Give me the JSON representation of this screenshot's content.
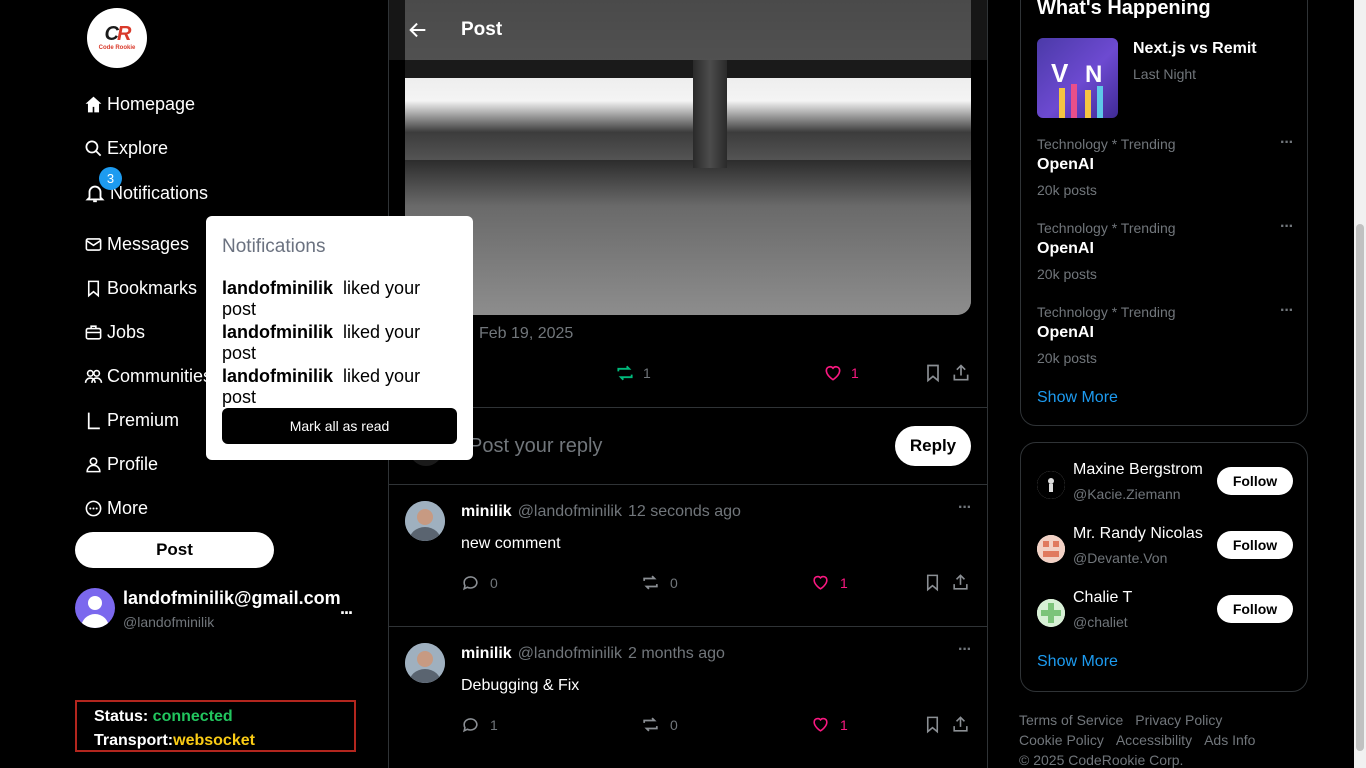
{
  "brand": {
    "logo_text": "CR",
    "logo_sub": "Code Rookie"
  },
  "nav": {
    "homepage": "Homepage",
    "explore": "Explore",
    "notifications": "Notifications",
    "notifications_count": "3",
    "messages": "Messages",
    "bookmarks": "Bookmarks",
    "jobs": "Jobs",
    "communities": "Communities",
    "premium": "Premium",
    "profile": "Profile",
    "more": "More",
    "post_button": "Post"
  },
  "account": {
    "email": "landofminilik@gmail.com",
    "handle": "@landofminilik",
    "more": "..."
  },
  "status": {
    "status_label": "Status: ",
    "status_value": "connected",
    "transport_label": "Transport:",
    "transport_value": "websocket"
  },
  "notifications_popover": {
    "title": "Notifications",
    "items": [
      {
        "user": "landofminilik",
        "action": "liked your post"
      },
      {
        "user": "landofminilik",
        "action": "liked your post"
      },
      {
        "user": "landofminilik",
        "action": "liked your post"
      }
    ],
    "mark_all": "Mark all as read"
  },
  "main": {
    "header_title": "Post",
    "date": "Feb 19, 2025",
    "repost_count": "1",
    "like_count": "1",
    "reply_placeholder": "Post your reply",
    "reply_button": "Reply",
    "comments": [
      {
        "name": "minilik",
        "handle": "@landofminilik",
        "time": "12 seconds ago",
        "text": "new comment",
        "replies": "0",
        "reposts": "0",
        "likes": "1"
      },
      {
        "name": "minilik",
        "handle": "@landofminilik",
        "time": "2 months ago",
        "text": "Debugging & Fix",
        "replies": "1",
        "reposts": "0",
        "likes": "1"
      }
    ]
  },
  "right": {
    "happening_title": "What's Happening",
    "event": {
      "title": "Next.js vs Remit",
      "time": "Last Night"
    },
    "trends": [
      {
        "category": "Technology * Trending",
        "tag": "OpenAI",
        "count": "20k posts"
      },
      {
        "category": "Technology * Trending",
        "tag": "OpenAI",
        "count": "20k posts"
      },
      {
        "category": "Technology * Trending",
        "tag": "OpenAI",
        "count": "20k posts"
      }
    ],
    "show_more": "Show More",
    "who_to_follow": [
      {
        "name": "Maxine Bergstrom",
        "handle": "@Kacie.Ziemann",
        "button": "Follow"
      },
      {
        "name": "Mr. Randy Nicolas",
        "handle": "@Devante.Von",
        "button": "Follow"
      },
      {
        "name": "Chalie T",
        "handle": "@chaliet",
        "button": "Follow"
      }
    ],
    "show_more_2": "Show More",
    "footer": {
      "terms": "Terms of Service",
      "privacy": "Privacy Policy",
      "cookie": "Cookie Policy",
      "accessibility": "Accessibility",
      "ads": "Ads Info",
      "copyright": "© 2025 CodeRookie Corp."
    }
  },
  "colors": {
    "accent": "#1d9bf0",
    "like": "#f91880",
    "repost": "#00ba7c",
    "status_ok": "#22c55e",
    "transport": "#facc15"
  }
}
